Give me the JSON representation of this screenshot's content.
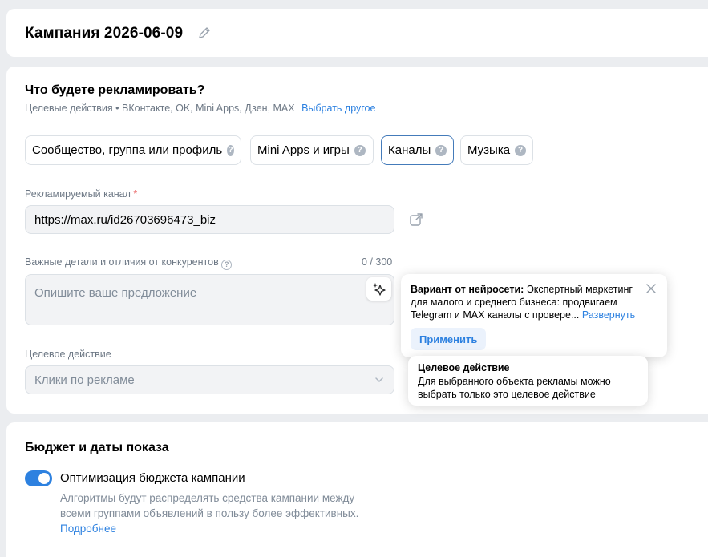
{
  "campaign": {
    "title": "Кампания 2026-06-09"
  },
  "advertise": {
    "heading": "Что будете рекламировать?",
    "subtitle": "Целевые действия • ВКонтакте, OK, Mini Apps, Дзен, MAX",
    "change_link": "Выбрать другое",
    "chips": [
      {
        "label": "Сообщество, группа или профиль"
      },
      {
        "label": "Mini Apps и игры"
      },
      {
        "label": "Каналы"
      },
      {
        "label": "Музыка"
      }
    ]
  },
  "channel": {
    "label": "Рекламируемый канал",
    "required_mark": "*",
    "value": "https://max.ru/id26703696473_biz"
  },
  "details": {
    "label": "Важные детали и отличия от конкурентов",
    "counter": "0 / 300",
    "placeholder": "Опишите ваше предложение"
  },
  "target_action": {
    "label": "Целевое действие",
    "placeholder": "Клики по рекламе"
  },
  "ai_suggestion": {
    "prefix": "Вариант от нейросети:",
    "text": "Экспертный маркетинг для малого и среднего бизнеса: продвигаем Telegram и MAX каналы с провере...",
    "expand_link": "Развернуть",
    "apply_label": "Применить"
  },
  "hint": {
    "title": "Целевое действие",
    "text": "Для выбранного объекта рекламы можно выбрать только это целевое действие"
  },
  "budget": {
    "heading": "Бюджет и даты показа",
    "toggle_label": "Оптимизация бюджета кампании",
    "toggle_on": true,
    "description": "Алгоритмы будут распределять средства кампании между всеми группами объявлений в пользу более эффективных.",
    "more_link": "Подробнее"
  },
  "colors": {
    "accent": "#2d81e0",
    "background": "#ebedf0",
    "muted": "#6d7885"
  }
}
